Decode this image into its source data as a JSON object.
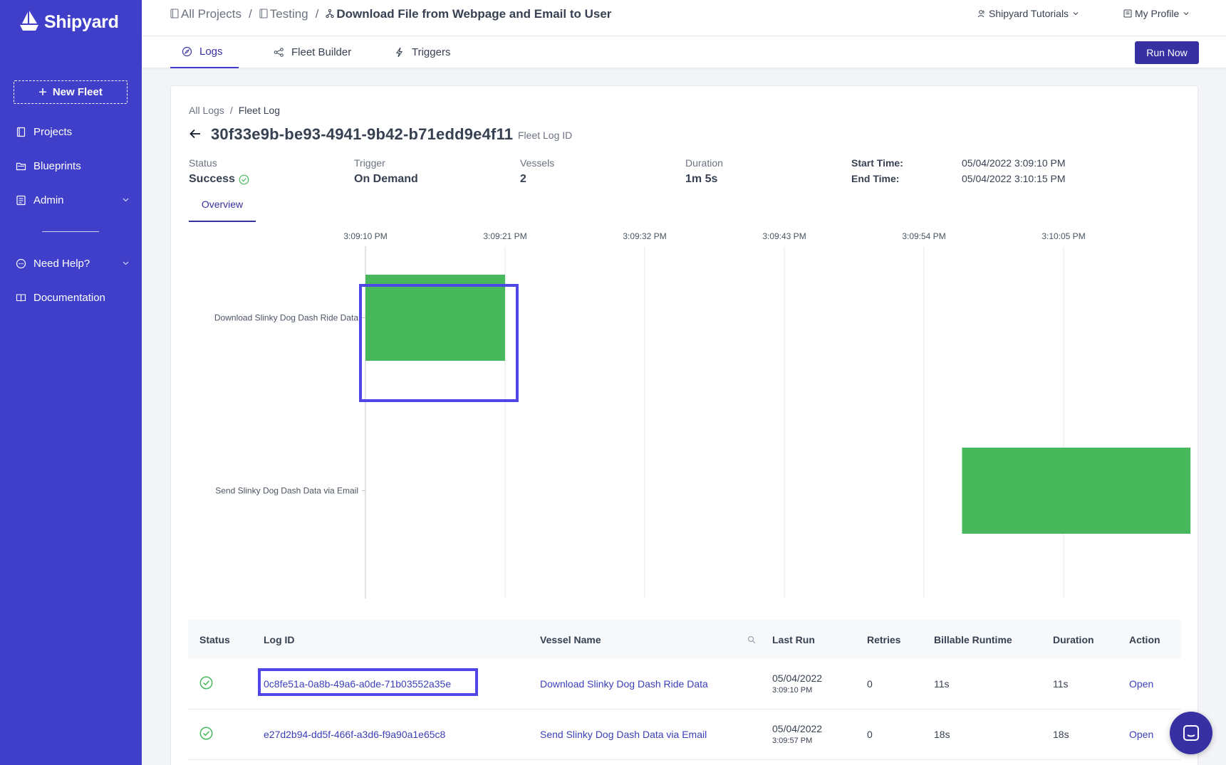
{
  "brand": {
    "name": "Shipyard"
  },
  "sidebar": {
    "new_fleet": "New Fleet",
    "items": [
      {
        "label": "Projects"
      },
      {
        "label": "Blueprints"
      },
      {
        "label": "Admin"
      },
      {
        "label": "Need Help?"
      },
      {
        "label": "Documentation"
      }
    ]
  },
  "breadcrumb": {
    "all_projects": "All Projects",
    "project": "Testing",
    "fleet": "Download File from Webpage and Email to User"
  },
  "header": {
    "org": "Shipyard Tutorials",
    "profile": "My Profile"
  },
  "tabs": [
    {
      "label": "Logs"
    },
    {
      "label": "Fleet Builder"
    },
    {
      "label": "Triggers"
    }
  ],
  "run_now": "Run Now",
  "log": {
    "crumb_all": "All Logs",
    "crumb_current": "Fleet Log",
    "id": "30f33e9b-be93-4941-9b42-b71edd9e4f11",
    "id_label": "Fleet Log ID",
    "status_label": "Status",
    "status": "Success",
    "trigger_label": "Trigger",
    "trigger": "On Demand",
    "vessels_label": "Vessels",
    "vessels": "2",
    "duration_label": "Duration",
    "duration": "1m 5s",
    "start_label": "Start Time:",
    "start": "05/04/2022 3:09:10 PM",
    "end_label": "End Time:",
    "end": "05/04/2022 3:10:15 PM",
    "overview_tab": "Overview"
  },
  "chart_data": {
    "type": "gantt",
    "x_ticks": [
      "3:09:10 PM",
      "3:09:21 PM",
      "3:09:32 PM",
      "3:09:43 PM",
      "3:09:54 PM",
      "3:10:05 PM"
    ],
    "x_tick_seconds": [
      0,
      11,
      22,
      33,
      44,
      55
    ],
    "x_range_seconds": [
      0,
      65
    ],
    "bars": [
      {
        "label": "Download Slinky Dog Dash Ride Data",
        "start": 0,
        "end": 11,
        "color": "#48b85c"
      },
      {
        "label": "Send Slinky Dog Dash Data via Email",
        "start": 47,
        "end": 65,
        "color": "#48b85c"
      }
    ]
  },
  "table": {
    "headers": {
      "status": "Status",
      "log_id": "Log ID",
      "vessel": "Vessel Name",
      "last_run": "Last Run",
      "retries": "Retries",
      "billable": "Billable Runtime",
      "duration": "Duration",
      "action": "Action"
    },
    "rows": [
      {
        "log_id": "0c8fe51a-0a8b-49a6-a0de-71b03552a35e",
        "vessel": "Download Slinky Dog Dash Ride Data",
        "date": "05/04/2022",
        "time": "3:09:10 PM",
        "retries": "0",
        "billable": "11s",
        "duration": "11s",
        "action": "Open"
      },
      {
        "log_id": "e27d2b94-dd5f-466f-a3d6-f9a90a1e65c8",
        "vessel": "Send Slinky Dog Dash Data via Email",
        "date": "05/04/2022",
        "time": "3:09:57 PM",
        "retries": "0",
        "billable": "18s",
        "duration": "18s",
        "action": "Open"
      }
    ]
  },
  "colors": {
    "sidebar": "#3f3fc9",
    "accent": "#3730a3",
    "success": "#48b85c",
    "highlight": "#4f46e5"
  }
}
